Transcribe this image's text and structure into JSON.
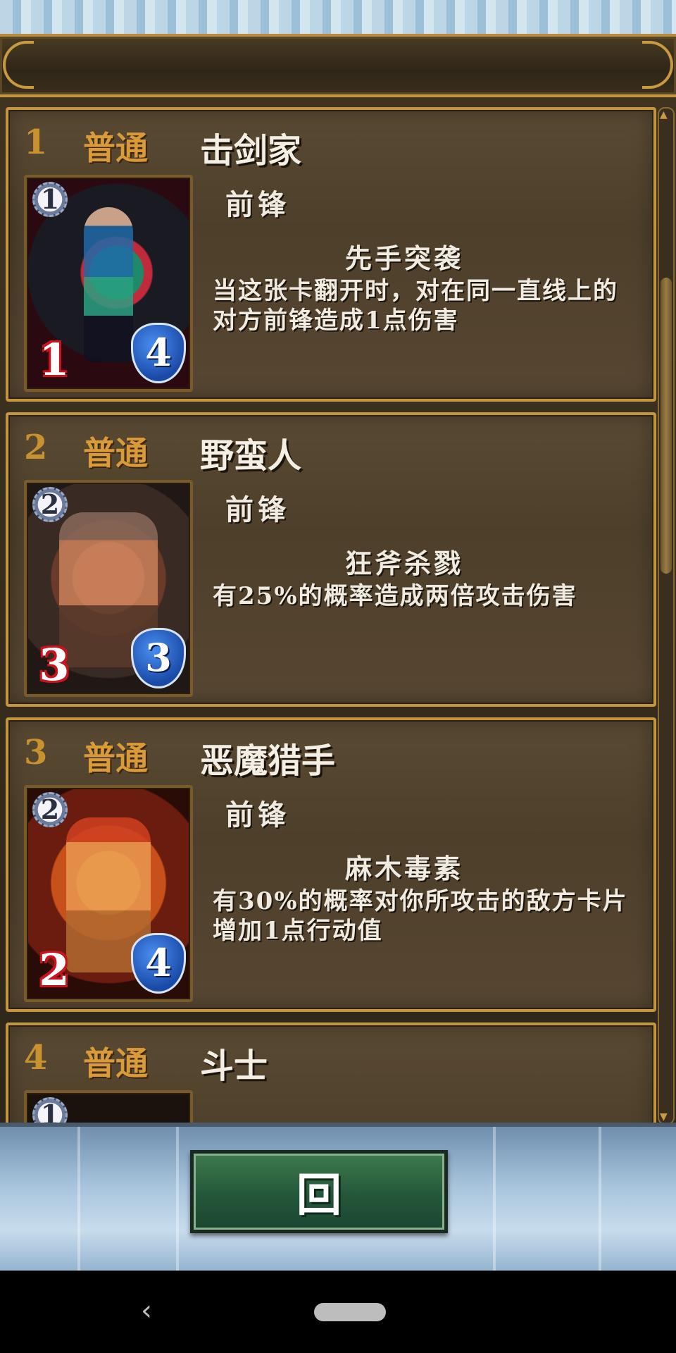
{
  "cards": [
    {
      "index": "1",
      "rarity": "普通",
      "name": "击剑家",
      "cost": "1",
      "attack": "1",
      "defense": "4",
      "role": "前锋",
      "skill_name": "先手突袭",
      "skill_desc": "当这张卡翻开时，对在同一直线上的对方前锋造成1点伤害"
    },
    {
      "index": "2",
      "rarity": "普通",
      "name": "野蛮人",
      "cost": "2",
      "attack": "3",
      "defense": "3",
      "role": "前锋",
      "skill_name": "狂斧杀戮",
      "skill_desc": "有25%的概率造成两倍攻击伤害"
    },
    {
      "index": "3",
      "rarity": "普通",
      "name": "恶魔猎手",
      "cost": "2",
      "attack": "2",
      "defense": "4",
      "role": "前锋",
      "skill_name": "麻木毒素",
      "skill_desc": "有30%的概率对你所攻击的敌方卡片增加1点行动值"
    },
    {
      "index": "4",
      "rarity": "普通",
      "name": "斗士",
      "cost": "1"
    }
  ],
  "back_button_label": "回",
  "navbar": {
    "back_icon": "‹"
  }
}
